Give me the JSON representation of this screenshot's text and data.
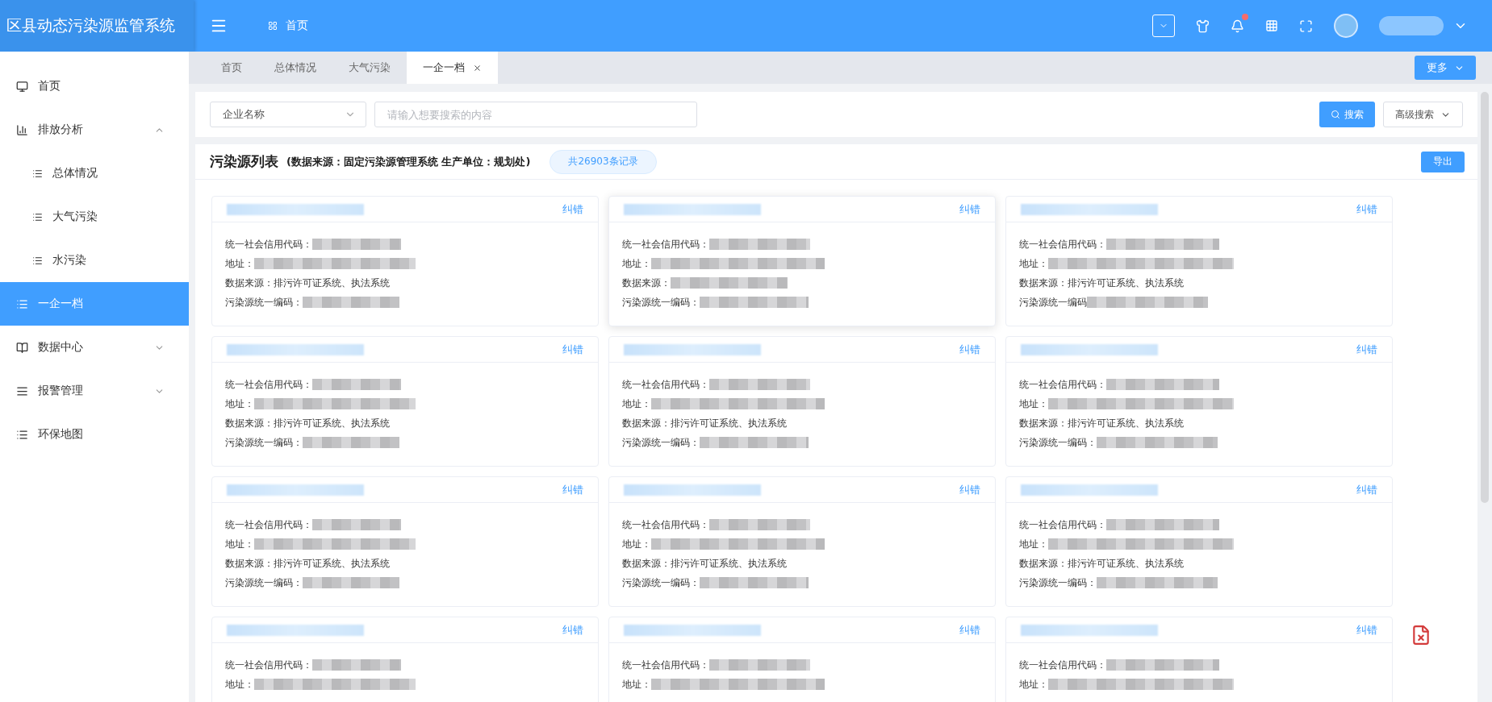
{
  "header": {
    "title": "区县动态污染源监管系统",
    "breadcrumb": "首页",
    "notification_dot": true
  },
  "sidebar": {
    "items": [
      {
        "label": "首页",
        "selected": false
      },
      {
        "label": "排放分析",
        "selected": false,
        "expanded": true,
        "children": [
          {
            "label": "总体情况",
            "selected": false
          },
          {
            "label": "大气污染",
            "selected": false
          },
          {
            "label": "水污染",
            "selected": false
          }
        ]
      },
      {
        "label": "一企一档",
        "selected": true
      },
      {
        "label": "数据中心",
        "selected": false,
        "expanded": false
      },
      {
        "label": "报警管理",
        "selected": false,
        "expanded": false
      },
      {
        "label": "环保地图",
        "selected": false
      }
    ]
  },
  "tabs": [
    {
      "label": "首页",
      "selected": false
    },
    {
      "label": "总体情况",
      "selected": false
    },
    {
      "label": "大气污染",
      "selected": false
    },
    {
      "label": "一企一档",
      "selected": true
    }
  ],
  "more_button": "更多",
  "search": {
    "select": "企业名称",
    "placeholder": "请输入想要搜索的内容",
    "search_button": "搜索",
    "advanced_button": "高级搜索"
  },
  "list": {
    "title": "污染源列表",
    "subtitle": "(数据来源：固定污染源管理系统 生产单位：规划处)",
    "count": "共26903条记录",
    "export_button": "导出",
    "cards": [
      {
        "action": "纠错",
        "hovered": false,
        "fields": [
          {
            "label": "统一社会信用代码："
          },
          {
            "label": "地址："
          },
          {
            "label": "数据来源：",
            "value": "排污许可证系统、执法系统"
          },
          {
            "label": "污染源统一编码："
          }
        ]
      },
      {
        "action": "纠错",
        "hovered": true,
        "fields": [
          {
            "label": "统一社会信用代码："
          },
          {
            "label": "地址："
          },
          {
            "label": "数据来源："
          },
          {
            "label": "污染源统一编码："
          }
        ]
      },
      {
        "action": "纠错",
        "hovered": false,
        "fields": [
          {
            "label": "统一社会信用代码："
          },
          {
            "label": "地址："
          },
          {
            "label": "数据来源：",
            "value": "排污许可证系统、执法系统"
          },
          {
            "label": "污染源统一编码"
          }
        ]
      },
      {
        "action": "纠错",
        "hovered": false,
        "fields": [
          {
            "label": "统一社会信用代码："
          },
          {
            "label": "地址："
          },
          {
            "label": "数据来源：",
            "value": "排污许可证系统、执法系统"
          },
          {
            "label": "污染源统一编码："
          }
        ]
      },
      {
        "action": "纠错",
        "hovered": false,
        "fields": [
          {
            "label": "统一社会信用代码："
          },
          {
            "label": "地址："
          },
          {
            "label": "数据来源：",
            "value": "排污许可证系统、执法系统"
          },
          {
            "label": "污染源统一编码："
          }
        ]
      },
      {
        "action": "纠错",
        "hovered": false,
        "fields": [
          {
            "label": "统一社会信用代码："
          },
          {
            "label": "地址："
          },
          {
            "label": "数据来源：",
            "value": "排污许可证系统、执法系统"
          },
          {
            "label": "污染源统一编码："
          }
        ]
      },
      {
        "action": "纠错",
        "hovered": false,
        "fields": [
          {
            "label": "统一社会信用代码："
          },
          {
            "label": "地址："
          },
          {
            "label": "数据来源：",
            "value": "排污许可证系统、执法系统"
          },
          {
            "label": "污染源统一编码："
          }
        ]
      },
      {
        "action": "纠错",
        "hovered": false,
        "fields": [
          {
            "label": "统一社会信用代码："
          },
          {
            "label": "地址："
          },
          {
            "label": "数据来源：",
            "value": "排污许可证系统、执法系统"
          },
          {
            "label": "污染源统一编码："
          }
        ]
      },
      {
        "action": "纠错",
        "hovered": false,
        "fields": [
          {
            "label": "统一社会信用代码："
          },
          {
            "label": "地址："
          },
          {
            "label": "数据来源：",
            "value": "排污许可证系统、执法系统"
          },
          {
            "label": "污染源统一编码："
          }
        ]
      },
      {
        "action": "纠错",
        "hovered": false,
        "fields": [
          {
            "label": "统一社会信用代码："
          },
          {
            "label": "地址："
          }
        ]
      },
      {
        "action": "纠错",
        "hovered": false,
        "fields": [
          {
            "label": "统一社会信用代码："
          },
          {
            "label": "地址："
          }
        ]
      },
      {
        "action": "纠错",
        "hovered": false,
        "fields": [
          {
            "label": "统一社会信用代码："
          },
          {
            "label": "地址："
          }
        ]
      }
    ]
  }
}
